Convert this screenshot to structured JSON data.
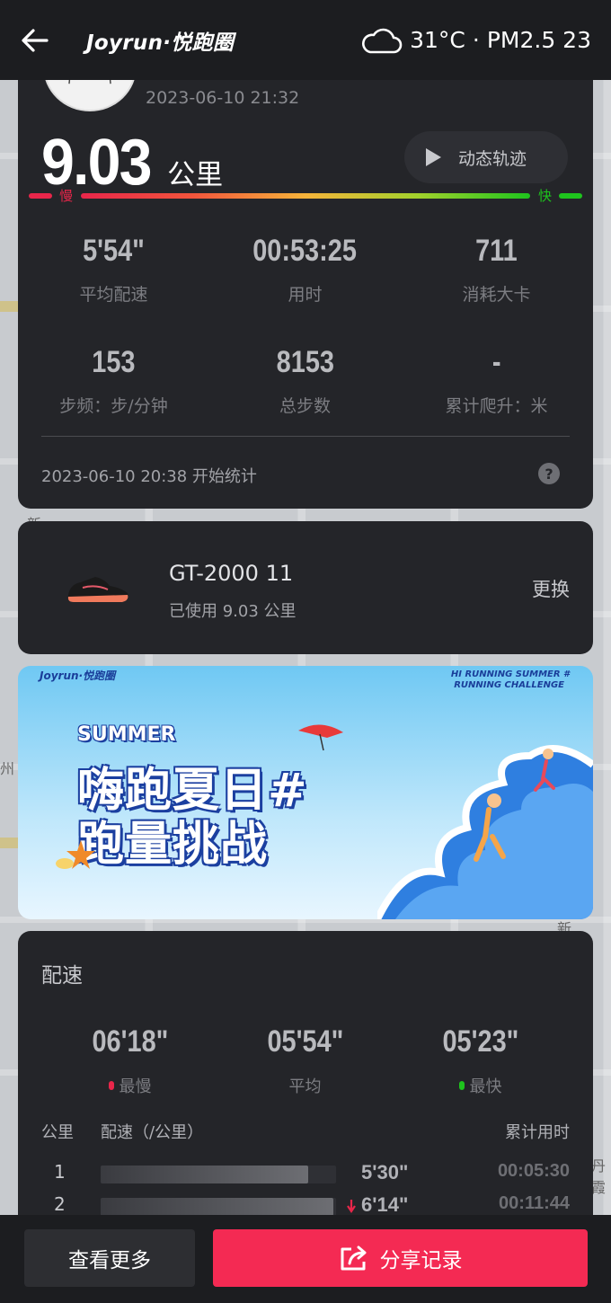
{
  "header": {
    "brand": "Joyrun·悦跑圈",
    "temperature": "31°C",
    "separator": "·",
    "air_quality": "PM2.5 23"
  },
  "summary": {
    "datetime": "2023-06-10 21:32",
    "distance_value": "9.03",
    "distance_unit": "公里",
    "track_button": "动态轨迹",
    "speed_slow": "慢",
    "speed_fast": "快",
    "stats": [
      {
        "value": "5'54\"",
        "label": "平均配速"
      },
      {
        "value": "00:53:25",
        "label": "用时"
      },
      {
        "value": "711",
        "label": "消耗大卡"
      },
      {
        "value": "153",
        "label": "步频：步/分钟"
      },
      {
        "value": "8153",
        "label": "总步数"
      },
      {
        "value": "-",
        "label": "累计爬升：米"
      }
    ],
    "start_time": "2023-06-10 20:38  开始统计"
  },
  "shoe": {
    "name": "GT-2000 11",
    "used": "已使用 9.03 公里",
    "change": "更换"
  },
  "banner": {
    "brand": "Joyrun·悦跑圈",
    "tag_line1": "HI RUNNING SUMMER #",
    "tag_line2": "RUNNING CHALLENGE",
    "summer": "SUMMER",
    "title_line1": "嗨跑夏日#",
    "title_line2": "跑量挑战"
  },
  "pace": {
    "title": "配速",
    "slowest": {
      "value": "06'18\"",
      "label": "最慢",
      "color": "#e8264a"
    },
    "average": {
      "value": "05'54\"",
      "label": "平均"
    },
    "fastest": {
      "value": "05'23\"",
      "label": "最快",
      "color": "#1ec41d"
    },
    "col_km": "公里",
    "col_pace": "配速（/公里）",
    "col_time": "累计用时",
    "rows": [
      {
        "km": "1",
        "pace": "5'30\"",
        "time": "00:05:30",
        "fraction": 0.88,
        "slow": false
      },
      {
        "km": "2",
        "pace": "6'14\"",
        "time": "00:11:44",
        "fraction": 0.99,
        "slow": true
      }
    ]
  },
  "map_labels": [
    "新",
    "州",
    "新",
    "丹霞"
  ],
  "bottom": {
    "more": "查看更多",
    "share": "分享记录"
  }
}
